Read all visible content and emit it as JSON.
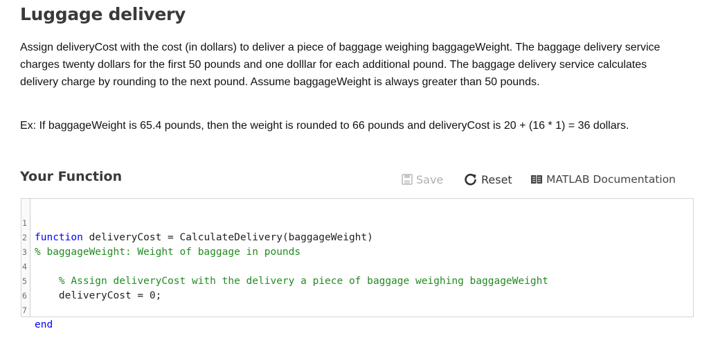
{
  "page": {
    "title": "Luggage delivery",
    "description": "Assign deliveryCost with the cost (in dollars) to deliver a piece of baggage weighing baggageWeight. The baggage delivery service charges twenty dollars for the first 50 pounds and one dolllar for each additional pound. The baggage delivery service calculates delivery charge by rounding to the next pound. Assume baggageWeight is always greater than 50 pounds.",
    "example": "Ex: If baggageWeight is 65.4 pounds, then the weight is rounded to 66 pounds and deliveryCost is 20 + (16 * 1) = 36 dollars."
  },
  "function_section": {
    "title": "Your Function",
    "toolbar": {
      "save_label": "Save",
      "reset_label": "Reset",
      "docs_label": "MATLAB Documentation"
    }
  },
  "editor": {
    "lines": [
      {
        "num": "1",
        "keyword": "function",
        "text": " deliveryCost = CalculateDelivery(baggageWeight)",
        "comment": ""
      },
      {
        "num": "2",
        "keyword": "",
        "text": "",
        "comment": "% baggageWeight: Weight of baggage in pounds"
      },
      {
        "num": "3",
        "keyword": "",
        "text": "",
        "comment": ""
      },
      {
        "num": "4",
        "keyword": "",
        "text": "    ",
        "comment": "% Assign deliveryCost with the delivery a piece of baggage weighing baggageWeight"
      },
      {
        "num": "5",
        "keyword": "",
        "text": "    deliveryCost = 0;",
        "comment": ""
      },
      {
        "num": "6",
        "keyword": "",
        "text": "",
        "comment": ""
      },
      {
        "num": "7",
        "keyword": "end",
        "text": "",
        "comment": ""
      }
    ]
  },
  "colors": {
    "keyword": "#0000ff",
    "comment": "#228b22",
    "save_disabled": "#b0b0b0"
  }
}
